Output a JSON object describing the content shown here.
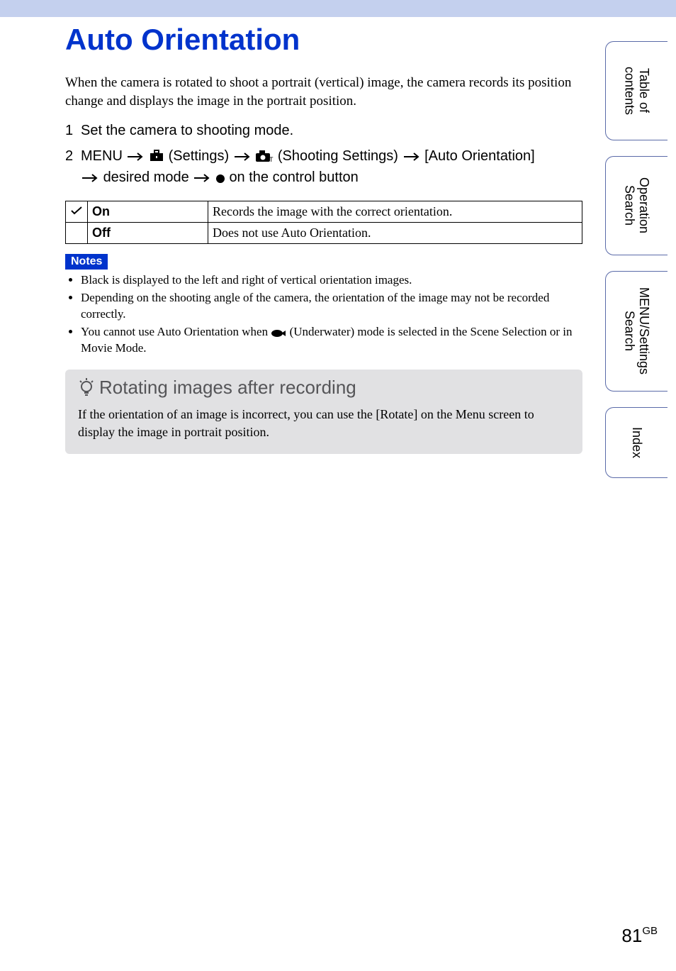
{
  "title": "Auto Orientation",
  "intro": "When the camera is rotated to shoot a portrait (vertical) image, the camera records its position change and displays the image in the portrait position.",
  "steps": {
    "s1": {
      "num": "1",
      "text": "Set the camera to shooting mode."
    },
    "s2": {
      "num": "2",
      "menu": "MENU",
      "settings": "(Settings)",
      "shooting": "(Shooting Settings)",
      "target": "[Auto Orientation]",
      "cont1": "desired mode",
      "cont2": "on the control button"
    }
  },
  "opts": {
    "on": {
      "name": "On",
      "desc": "Records the image with the correct orientation."
    },
    "off": {
      "name": "Off",
      "desc": "Does not use Auto Orientation."
    }
  },
  "notes_label": "Notes",
  "notes": {
    "n1": "Black is displayed to the left and right of vertical orientation images.",
    "n2": "Depending on the shooting angle of the camera, the orientation of the image may not be recorded correctly.",
    "n3a": "You cannot use Auto Orientation when ",
    "n3b": " (Underwater) mode is selected in the Scene Selection or in Movie Mode."
  },
  "tip": {
    "title": "Rotating images after recording",
    "body": "If the orientation of an image is incorrect, you can use the [Rotate] on the Menu screen to display the image in portrait position."
  },
  "tabs": {
    "t1": "Table of\ncontents",
    "t2": "Operation\nSearch",
    "t3": "MENU/Settings\nSearch",
    "t4": "Index"
  },
  "page": {
    "num": "81",
    "suffix": "GB"
  }
}
